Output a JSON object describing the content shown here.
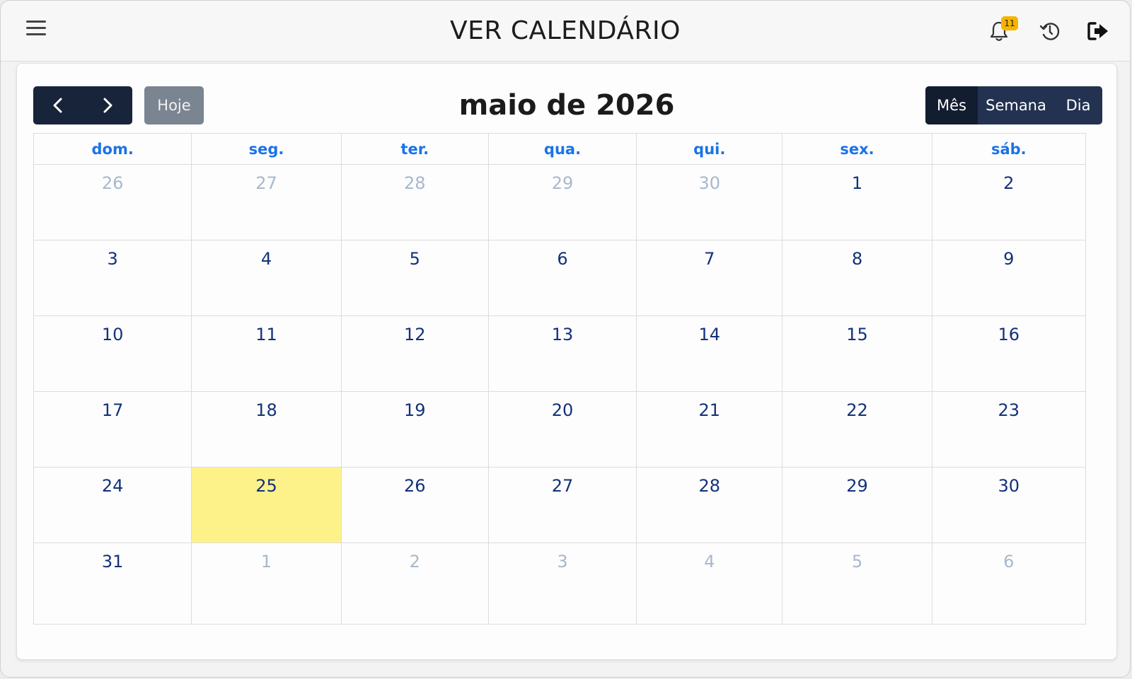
{
  "header": {
    "title": "VER CALENDÁRIO",
    "notifications_count": "11"
  },
  "toolbar": {
    "today_label": "Hoje",
    "month_title": "maio de 2026",
    "views": [
      "Mês",
      "Semana",
      "Dia"
    ],
    "active_view": "Mês"
  },
  "calendar": {
    "weekdays": [
      "dom.",
      "seg.",
      "ter.",
      "qua.",
      "qui.",
      "sex.",
      "sáb."
    ],
    "weeks": [
      [
        {
          "day": "26",
          "other": true
        },
        {
          "day": "27",
          "other": true
        },
        {
          "day": "28",
          "other": true
        },
        {
          "day": "29",
          "other": true
        },
        {
          "day": "30",
          "other": true
        },
        {
          "day": "1",
          "other": false
        },
        {
          "day": "2",
          "other": false
        }
      ],
      [
        {
          "day": "3",
          "other": false
        },
        {
          "day": "4",
          "other": false
        },
        {
          "day": "5",
          "other": false
        },
        {
          "day": "6",
          "other": false
        },
        {
          "day": "7",
          "other": false
        },
        {
          "day": "8",
          "other": false
        },
        {
          "day": "9",
          "other": false
        }
      ],
      [
        {
          "day": "10",
          "other": false
        },
        {
          "day": "11",
          "other": false
        },
        {
          "day": "12",
          "other": false
        },
        {
          "day": "13",
          "other": false
        },
        {
          "day": "14",
          "other": false
        },
        {
          "day": "15",
          "other": false
        },
        {
          "day": "16",
          "other": false
        }
      ],
      [
        {
          "day": "17",
          "other": false
        },
        {
          "day": "18",
          "other": false
        },
        {
          "day": "19",
          "other": false
        },
        {
          "day": "20",
          "other": false
        },
        {
          "day": "21",
          "other": false
        },
        {
          "day": "22",
          "other": false
        },
        {
          "day": "23",
          "other": false
        }
      ],
      [
        {
          "day": "24",
          "other": false
        },
        {
          "day": "25",
          "other": false,
          "today": true
        },
        {
          "day": "26",
          "other": false
        },
        {
          "day": "27",
          "other": false
        },
        {
          "day": "28",
          "other": false
        },
        {
          "day": "29",
          "other": false
        },
        {
          "day": "30",
          "other": false
        }
      ],
      [
        {
          "day": "31",
          "other": false
        },
        {
          "day": "1",
          "other": true
        },
        {
          "day": "2",
          "other": true
        },
        {
          "day": "3",
          "other": true
        },
        {
          "day": "4",
          "other": true
        },
        {
          "day": "5",
          "other": true
        },
        {
          "day": "6",
          "other": true
        }
      ]
    ]
  },
  "colors": {
    "weekday_header": "#1a73e8",
    "day_number": "#13317a",
    "other_month_day": "#a8b8cc",
    "today_highlight": "#fdf28a",
    "nav_dark": "#18243a",
    "badge": "#f6b400"
  },
  "icons": {
    "menu": "hamburger-icon",
    "notifications": "bell-icon",
    "history": "history-icon",
    "logout": "logout-icon",
    "prev": "chevron-left-icon",
    "next": "chevron-right-icon"
  }
}
